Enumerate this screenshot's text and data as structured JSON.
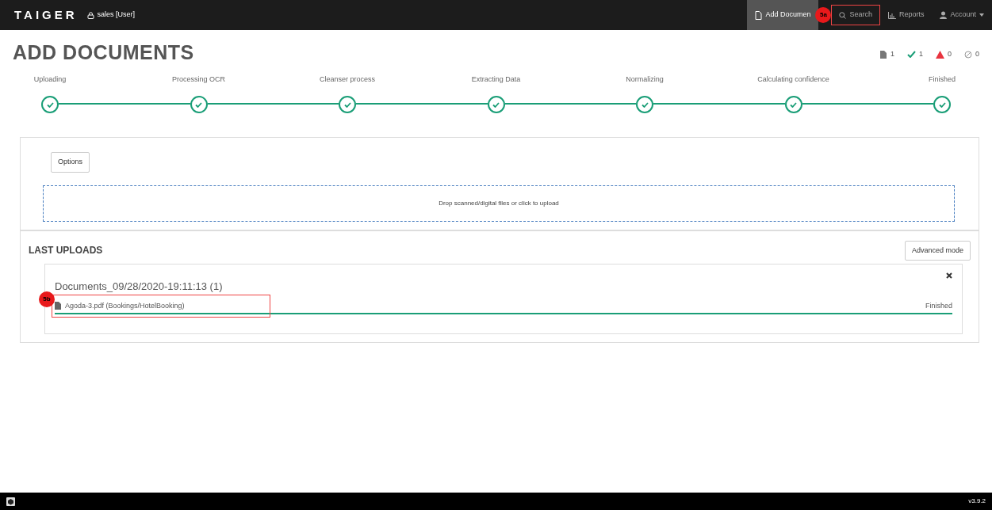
{
  "navbar": {
    "brand": "TAIGER",
    "user": "sales [User]",
    "items": [
      {
        "label": "Add Documen",
        "kind": "document",
        "selected": true
      },
      {
        "label": "Search",
        "kind": "search",
        "selected": false
      },
      {
        "label": "Reports",
        "kind": "chart",
        "selected": false
      },
      {
        "label": "Account",
        "kind": "person",
        "selected": false,
        "dropdown": true
      }
    ]
  },
  "page_title": "ADD DOCUMENTS",
  "stats": [
    {
      "kind": "files",
      "count": "1",
      "color": "#777777"
    },
    {
      "kind": "success",
      "count": "1",
      "color": "#1a9e77"
    },
    {
      "kind": "error",
      "count": "0",
      "color": "#e8343f"
    },
    {
      "kind": "skipped",
      "count": "0",
      "color": "#999999"
    }
  ],
  "steps": [
    {
      "label": "Uploading",
      "done": true
    },
    {
      "label": "Processing OCR",
      "done": true
    },
    {
      "label": "Cleanser process",
      "done": true
    },
    {
      "label": "Extracting Data",
      "done": true
    },
    {
      "label": "Normalizing",
      "done": true
    },
    {
      "label": "Calculating confidence",
      "done": true
    },
    {
      "label": "Finished",
      "done": true
    }
  ],
  "upload_panel": {
    "options_button": "Options",
    "dropzone_text": "Drop scanned/digital files or click to upload"
  },
  "last_uploads": {
    "title": "LAST UPLOADS",
    "advanced_button": "Advanced mode",
    "batches": [
      {
        "title": "Documents_09/28/2020-19:11:13 (1)",
        "files": [
          {
            "name": "Agoda-3.pdf (Bookings/HotelBooking)",
            "status": "Finished",
            "level": 1
          }
        ]
      }
    ]
  },
  "annotations": [
    {
      "label": "5a"
    },
    {
      "label": "5b"
    }
  ],
  "footer": {
    "version": "v3.9.2"
  }
}
